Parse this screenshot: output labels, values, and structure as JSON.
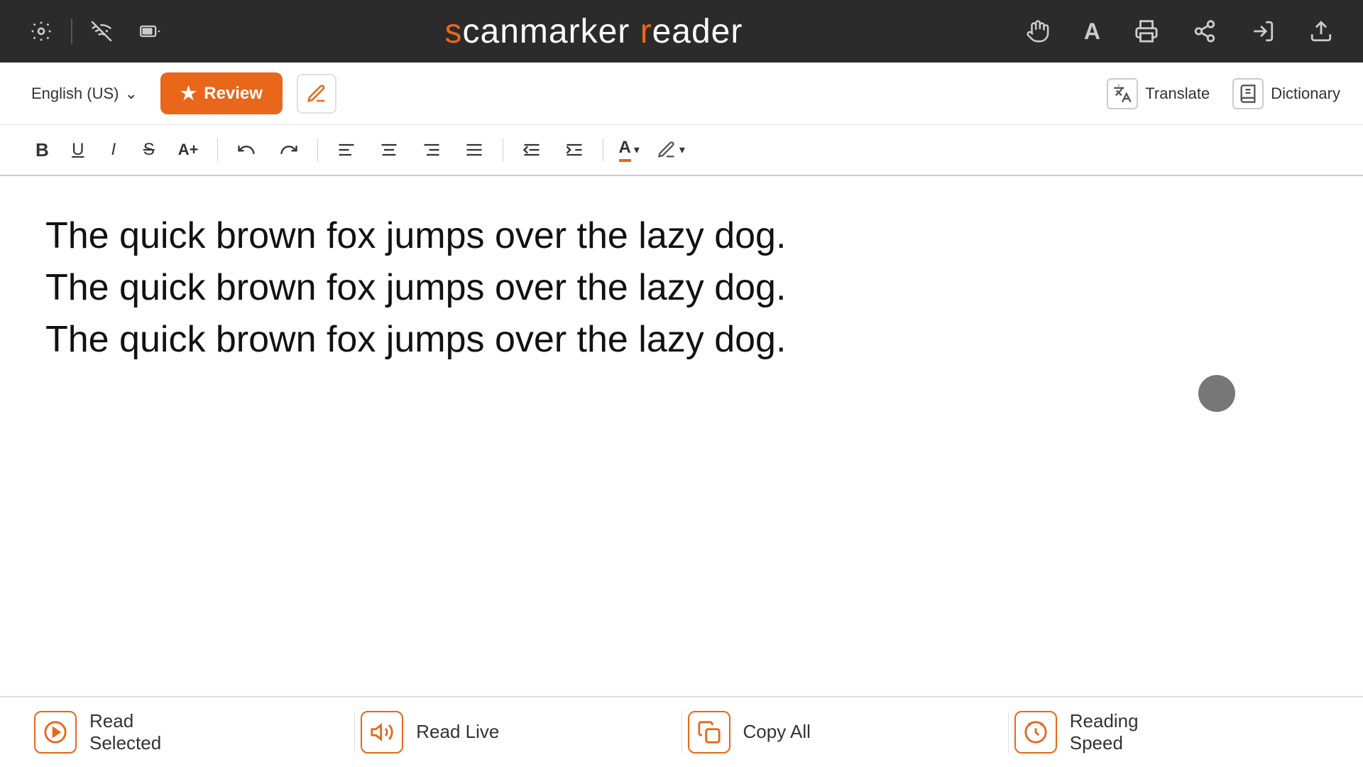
{
  "app": {
    "title_prefix": "s",
    "title_s": "s",
    "title_canmarker": "canmarker ",
    "title_r": "r",
    "title_eader": "eader",
    "full_title": "scanmarker reader"
  },
  "header": {
    "settings_icon": "⚙",
    "signal_icon": "📶",
    "battery_icon": "🔋",
    "gesture_icon": "✋",
    "font_icon": "A",
    "print_icon": "🖨",
    "share_icon": "🔗",
    "import_icon": "⤵",
    "export_icon": "⬆"
  },
  "toolbar1": {
    "language": "English (US)",
    "review_label": "Review",
    "translate_label": "Translate",
    "dictionary_label": "Dictionary"
  },
  "toolbar2": {
    "bold": "B",
    "underline": "U",
    "italic": "I",
    "strikethrough": "S",
    "font_size": "A+",
    "undo": "↩",
    "redo": "↪",
    "align_left": "≡",
    "align_center": "≡",
    "align_right": "≡",
    "align_justify": "≡",
    "indent_decrease": "⇤",
    "indent_increase": "⇥",
    "text_color": "A",
    "highlight_color": "✏"
  },
  "content": {
    "text_line1": "The quick brown fox jumps over the lazy dog.",
    "text_line2": "The quick brown fox jumps over the lazy dog.",
    "text_line3": "The quick brown fox jumps over the lazy dog."
  },
  "bottombar": {
    "read_selected_label": "Read\nSelected",
    "read_selected_line1": "Read",
    "read_selected_line2": "Selected",
    "read_live_label": "Read Live",
    "copy_all_label": "Copy All",
    "reading_speed_line1": "Reading",
    "reading_speed_line2": "Speed"
  }
}
